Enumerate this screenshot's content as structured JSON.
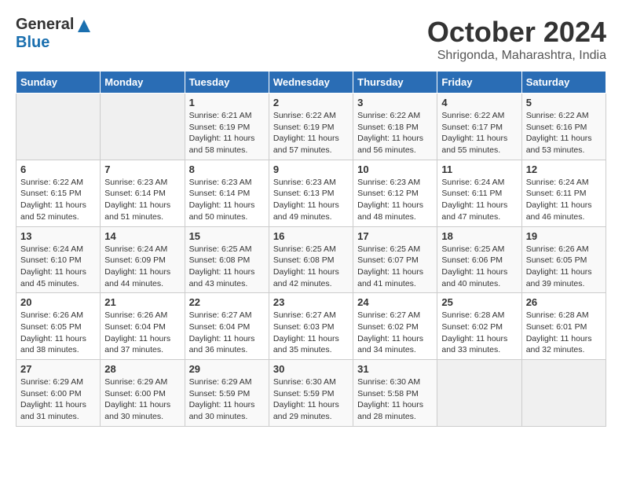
{
  "header": {
    "logo_general": "General",
    "logo_blue": "Blue",
    "month_title": "October 2024",
    "location": "Shrigonda, Maharashtra, India"
  },
  "weekdays": [
    "Sunday",
    "Monday",
    "Tuesday",
    "Wednesday",
    "Thursday",
    "Friday",
    "Saturday"
  ],
  "weeks": [
    [
      {
        "day": "",
        "sunrise": "",
        "sunset": "",
        "daylight": ""
      },
      {
        "day": "",
        "sunrise": "",
        "sunset": "",
        "daylight": ""
      },
      {
        "day": "1",
        "sunrise": "Sunrise: 6:21 AM",
        "sunset": "Sunset: 6:19 PM",
        "daylight": "Daylight: 11 hours and 58 minutes."
      },
      {
        "day": "2",
        "sunrise": "Sunrise: 6:22 AM",
        "sunset": "Sunset: 6:19 PM",
        "daylight": "Daylight: 11 hours and 57 minutes."
      },
      {
        "day": "3",
        "sunrise": "Sunrise: 6:22 AM",
        "sunset": "Sunset: 6:18 PM",
        "daylight": "Daylight: 11 hours and 56 minutes."
      },
      {
        "day": "4",
        "sunrise": "Sunrise: 6:22 AM",
        "sunset": "Sunset: 6:17 PM",
        "daylight": "Daylight: 11 hours and 55 minutes."
      },
      {
        "day": "5",
        "sunrise": "Sunrise: 6:22 AM",
        "sunset": "Sunset: 6:16 PM",
        "daylight": "Daylight: 11 hours and 53 minutes."
      }
    ],
    [
      {
        "day": "6",
        "sunrise": "Sunrise: 6:22 AM",
        "sunset": "Sunset: 6:15 PM",
        "daylight": "Daylight: 11 hours and 52 minutes."
      },
      {
        "day": "7",
        "sunrise": "Sunrise: 6:23 AM",
        "sunset": "Sunset: 6:14 PM",
        "daylight": "Daylight: 11 hours and 51 minutes."
      },
      {
        "day": "8",
        "sunrise": "Sunrise: 6:23 AM",
        "sunset": "Sunset: 6:14 PM",
        "daylight": "Daylight: 11 hours and 50 minutes."
      },
      {
        "day": "9",
        "sunrise": "Sunrise: 6:23 AM",
        "sunset": "Sunset: 6:13 PM",
        "daylight": "Daylight: 11 hours and 49 minutes."
      },
      {
        "day": "10",
        "sunrise": "Sunrise: 6:23 AM",
        "sunset": "Sunset: 6:12 PM",
        "daylight": "Daylight: 11 hours and 48 minutes."
      },
      {
        "day": "11",
        "sunrise": "Sunrise: 6:24 AM",
        "sunset": "Sunset: 6:11 PM",
        "daylight": "Daylight: 11 hours and 47 minutes."
      },
      {
        "day": "12",
        "sunrise": "Sunrise: 6:24 AM",
        "sunset": "Sunset: 6:11 PM",
        "daylight": "Daylight: 11 hours and 46 minutes."
      }
    ],
    [
      {
        "day": "13",
        "sunrise": "Sunrise: 6:24 AM",
        "sunset": "Sunset: 6:10 PM",
        "daylight": "Daylight: 11 hours and 45 minutes."
      },
      {
        "day": "14",
        "sunrise": "Sunrise: 6:24 AM",
        "sunset": "Sunset: 6:09 PM",
        "daylight": "Daylight: 11 hours and 44 minutes."
      },
      {
        "day": "15",
        "sunrise": "Sunrise: 6:25 AM",
        "sunset": "Sunset: 6:08 PM",
        "daylight": "Daylight: 11 hours and 43 minutes."
      },
      {
        "day": "16",
        "sunrise": "Sunrise: 6:25 AM",
        "sunset": "Sunset: 6:08 PM",
        "daylight": "Daylight: 11 hours and 42 minutes."
      },
      {
        "day": "17",
        "sunrise": "Sunrise: 6:25 AM",
        "sunset": "Sunset: 6:07 PM",
        "daylight": "Daylight: 11 hours and 41 minutes."
      },
      {
        "day": "18",
        "sunrise": "Sunrise: 6:25 AM",
        "sunset": "Sunset: 6:06 PM",
        "daylight": "Daylight: 11 hours and 40 minutes."
      },
      {
        "day": "19",
        "sunrise": "Sunrise: 6:26 AM",
        "sunset": "Sunset: 6:05 PM",
        "daylight": "Daylight: 11 hours and 39 minutes."
      }
    ],
    [
      {
        "day": "20",
        "sunrise": "Sunrise: 6:26 AM",
        "sunset": "Sunset: 6:05 PM",
        "daylight": "Daylight: 11 hours and 38 minutes."
      },
      {
        "day": "21",
        "sunrise": "Sunrise: 6:26 AM",
        "sunset": "Sunset: 6:04 PM",
        "daylight": "Daylight: 11 hours and 37 minutes."
      },
      {
        "day": "22",
        "sunrise": "Sunrise: 6:27 AM",
        "sunset": "Sunset: 6:04 PM",
        "daylight": "Daylight: 11 hours and 36 minutes."
      },
      {
        "day": "23",
        "sunrise": "Sunrise: 6:27 AM",
        "sunset": "Sunset: 6:03 PM",
        "daylight": "Daylight: 11 hours and 35 minutes."
      },
      {
        "day": "24",
        "sunrise": "Sunrise: 6:27 AM",
        "sunset": "Sunset: 6:02 PM",
        "daylight": "Daylight: 11 hours and 34 minutes."
      },
      {
        "day": "25",
        "sunrise": "Sunrise: 6:28 AM",
        "sunset": "Sunset: 6:02 PM",
        "daylight": "Daylight: 11 hours and 33 minutes."
      },
      {
        "day": "26",
        "sunrise": "Sunrise: 6:28 AM",
        "sunset": "Sunset: 6:01 PM",
        "daylight": "Daylight: 11 hours and 32 minutes."
      }
    ],
    [
      {
        "day": "27",
        "sunrise": "Sunrise: 6:29 AM",
        "sunset": "Sunset: 6:00 PM",
        "daylight": "Daylight: 11 hours and 31 minutes."
      },
      {
        "day": "28",
        "sunrise": "Sunrise: 6:29 AM",
        "sunset": "Sunset: 6:00 PM",
        "daylight": "Daylight: 11 hours and 30 minutes."
      },
      {
        "day": "29",
        "sunrise": "Sunrise: 6:29 AM",
        "sunset": "Sunset: 5:59 PM",
        "daylight": "Daylight: 11 hours and 30 minutes."
      },
      {
        "day": "30",
        "sunrise": "Sunrise: 6:30 AM",
        "sunset": "Sunset: 5:59 PM",
        "daylight": "Daylight: 11 hours and 29 minutes."
      },
      {
        "day": "31",
        "sunrise": "Sunrise: 6:30 AM",
        "sunset": "Sunset: 5:58 PM",
        "daylight": "Daylight: 11 hours and 28 minutes."
      },
      {
        "day": "",
        "sunrise": "",
        "sunset": "",
        "daylight": ""
      },
      {
        "day": "",
        "sunrise": "",
        "sunset": "",
        "daylight": ""
      }
    ]
  ]
}
